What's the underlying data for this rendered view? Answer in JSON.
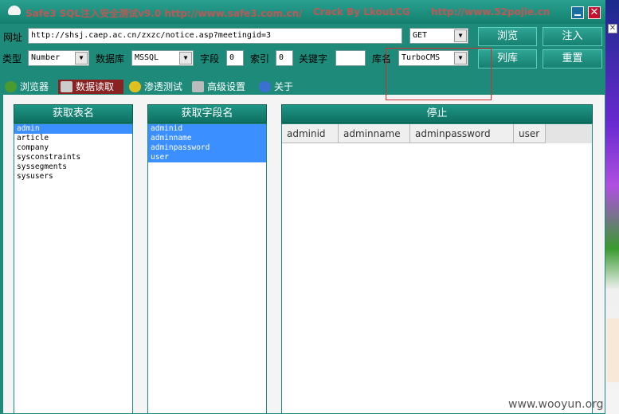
{
  "window": {
    "title_left": "Safe3 SQL注入安全测试v9.0   http://www.safe3.com.cn/",
    "title_mid": "Crack  By  LkouLCG",
    "title_right": "http://www.52pojie.cn",
    "close_glyph": "✕"
  },
  "url_row": {
    "label": "网址",
    "url_value": "http://shsj.caep.ac.cn/zxzc/notice.asp?meetingid=3",
    "method_value": "GET",
    "browse_label": "浏览",
    "inject_label": "注入"
  },
  "options_row": {
    "type_label": "类型",
    "type_value": "Number",
    "db_label": "数据库",
    "db_value": "MSSQL",
    "field_label": "字段",
    "field_value": "0",
    "index_label": "索引",
    "index_value": "0",
    "keyword_label": "关键字",
    "keyword_value": "",
    "dbname_label": "库名",
    "dbname_value": "TurboCMS",
    "list_db_label": "列库",
    "reset_label": "重置"
  },
  "tabs": [
    {
      "label": "浏览器",
      "icon": "globe-icon"
    },
    {
      "label": "数据读取",
      "icon": "database-icon"
    },
    {
      "label": "渗透测试",
      "icon": "radiation-icon"
    },
    {
      "label": "高级设置",
      "icon": "tools-icon"
    },
    {
      "label": "关于",
      "icon": "info-icon"
    }
  ],
  "data_panel": {
    "get_tables_label": "获取表名",
    "get_fields_label": "获取字段名",
    "stop_label": "停止",
    "tables": [
      "admin",
      "article",
      "company",
      "sysconstraints",
      "syssegments",
      "sysusers"
    ],
    "selected_table": "admin",
    "fields": [
      "adminid",
      "adminname",
      "adminpassword",
      "user"
    ],
    "columns": [
      "adminid",
      "adminname",
      "adminpassword",
      "user"
    ]
  },
  "watermark": "www.wooyun.org",
  "colors": {
    "window_bg": "#1d8a7a",
    "selection": "#3b8fff",
    "active_tab": "#8b2222",
    "annotation": "#d03030"
  }
}
